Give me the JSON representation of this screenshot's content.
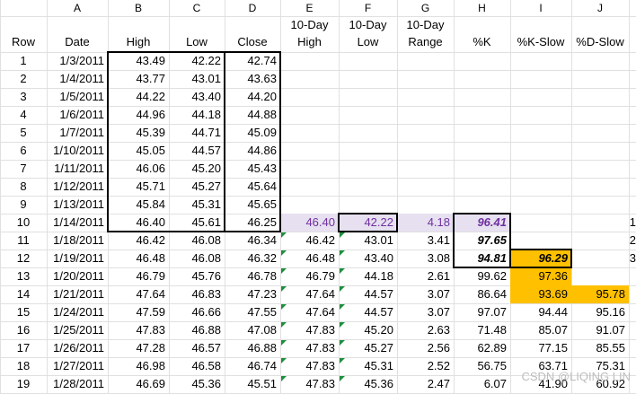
{
  "columns": [
    "A",
    "B",
    "C",
    "D",
    "E",
    "F",
    "G",
    "H",
    "I",
    "J"
  ],
  "headers": {
    "row": "Row",
    "date": "Date",
    "high": "High",
    "low": "Low",
    "close": "Close",
    "h10_l1": "10-Day",
    "h10_l2": "High",
    "l10_l1": "10-Day",
    "l10_l2": "Low",
    "r10_l1": "10-Day",
    "r10_l2": "Range",
    "pk": "%K",
    "pks": "%K-Slow",
    "pds": "%D-Slow"
  },
  "rows": [
    {
      "n": "1",
      "date": "1/3/2011",
      "high": "43.49",
      "low": "42.22",
      "close": "42.74",
      "h10": "",
      "l10": "",
      "rng": "",
      "k": "",
      "ks": "",
      "ds": ""
    },
    {
      "n": "2",
      "date": "1/4/2011",
      "high": "43.77",
      "low": "43.01",
      "close": "43.63",
      "h10": "",
      "l10": "",
      "rng": "",
      "k": "",
      "ks": "",
      "ds": ""
    },
    {
      "n": "3",
      "date": "1/5/2011",
      "high": "44.22",
      "low": "43.40",
      "close": "44.20",
      "h10": "",
      "l10": "",
      "rng": "",
      "k": "",
      "ks": "",
      "ds": ""
    },
    {
      "n": "4",
      "date": "1/6/2011",
      "high": "44.96",
      "low": "44.18",
      "close": "44.88",
      "h10": "",
      "l10": "",
      "rng": "",
      "k": "",
      "ks": "",
      "ds": ""
    },
    {
      "n": "5",
      "date": "1/7/2011",
      "high": "45.39",
      "low": "44.71",
      "close": "45.09",
      "h10": "",
      "l10": "",
      "rng": "",
      "k": "",
      "ks": "",
      "ds": ""
    },
    {
      "n": "6",
      "date": "1/10/2011",
      "high": "45.05",
      "low": "44.57",
      "close": "44.86",
      "h10": "",
      "l10": "",
      "rng": "",
      "k": "",
      "ks": "",
      "ds": ""
    },
    {
      "n": "7",
      "date": "1/11/2011",
      "high": "46.06",
      "low": "45.20",
      "close": "45.43",
      "h10": "",
      "l10": "",
      "rng": "",
      "k": "",
      "ks": "",
      "ds": ""
    },
    {
      "n": "8",
      "date": "1/12/2011",
      "high": "45.71",
      "low": "45.27",
      "close": "45.64",
      "h10": "",
      "l10": "",
      "rng": "",
      "k": "",
      "ks": "",
      "ds": ""
    },
    {
      "n": "9",
      "date": "1/13/2011",
      "high": "45.84",
      "low": "45.31",
      "close": "45.65",
      "h10": "",
      "l10": "",
      "rng": "",
      "k": "",
      "ks": "",
      "ds": ""
    },
    {
      "n": "10",
      "date": "1/14/2011",
      "high": "46.40",
      "low": "45.61",
      "close": "46.25",
      "h10": "46.40",
      "l10": "42.22",
      "rng": "4.18",
      "k": "96.41",
      "ks": "",
      "ds": ""
    },
    {
      "n": "11",
      "date": "1/18/2011",
      "high": "46.42",
      "low": "46.08",
      "close": "46.34",
      "h10": "46.42",
      "l10": "43.01",
      "rng": "3.41",
      "k": "97.65",
      "ks": "",
      "ds": ""
    },
    {
      "n": "12",
      "date": "1/19/2011",
      "high": "46.48",
      "low": "46.08",
      "close": "46.32",
      "h10": "46.48",
      "l10": "43.40",
      "rng": "3.08",
      "k": "94.81",
      "ks": "96.29",
      "ds": ""
    },
    {
      "n": "13",
      "date": "1/20/2011",
      "high": "46.79",
      "low": "45.76",
      "close": "46.78",
      "h10": "46.79",
      "l10": "44.18",
      "rng": "2.61",
      "k": "99.62",
      "ks": "97.36",
      "ds": ""
    },
    {
      "n": "14",
      "date": "1/21/2011",
      "high": "47.64",
      "low": "46.83",
      "close": "47.23",
      "h10": "47.64",
      "l10": "44.57",
      "rng": "3.07",
      "k": "86.64",
      "ks": "93.69",
      "ds": "95.78"
    },
    {
      "n": "15",
      "date": "1/24/2011",
      "high": "47.59",
      "low": "46.66",
      "close": "47.55",
      "h10": "47.64",
      "l10": "44.57",
      "rng": "3.07",
      "k": "97.07",
      "ks": "94.44",
      "ds": "95.16"
    },
    {
      "n": "16",
      "date": "1/25/2011",
      "high": "47.83",
      "low": "46.88",
      "close": "47.08",
      "h10": "47.83",
      "l10": "45.20",
      "rng": "2.63",
      "k": "71.48",
      "ks": "85.07",
      "ds": "91.07"
    },
    {
      "n": "17",
      "date": "1/26/2011",
      "high": "47.28",
      "low": "46.57",
      "close": "46.88",
      "h10": "47.83",
      "l10": "45.27",
      "rng": "2.56",
      "k": "62.89",
      "ks": "77.15",
      "ds": "85.55"
    },
    {
      "n": "18",
      "date": "1/27/2011",
      "high": "46.98",
      "low": "46.58",
      "close": "46.74",
      "h10": "47.83",
      "l10": "45.31",
      "rng": "2.52",
      "k": "56.75",
      "ks": "63.71",
      "ds": "75.31"
    },
    {
      "n": "19",
      "date": "1/28/2011",
      "high": "46.69",
      "low": "45.36",
      "close": "45.51",
      "h10": "47.83",
      "l10": "45.36",
      "rng": "2.47",
      "k": "6.07",
      "ks": "41.90",
      "ds": "60.92"
    }
  ],
  "side_labels": [
    "1",
    "2",
    "3"
  ],
  "watermark": "CSDN @LIQING LIN",
  "colors": {
    "purple": "#7030a0",
    "lavender": "#e6e0f0",
    "orange": "#ffc000",
    "green_marker": "#1e8e3e"
  }
}
